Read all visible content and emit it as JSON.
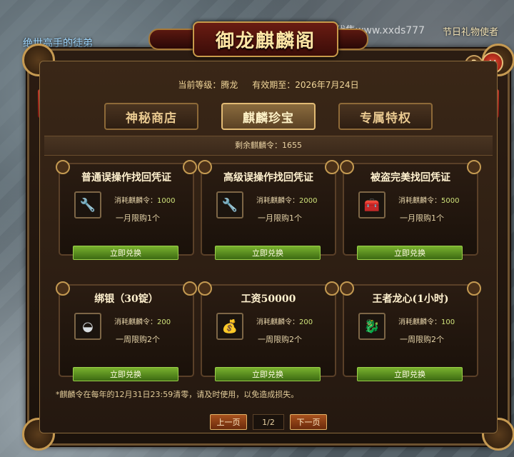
{
  "scene": {
    "top_left_text": "绝世高手的徒弟",
    "top_right_text": "节日礼物使者",
    "watermark": "代售www.xxds777"
  },
  "window": {
    "title": "御龙麒麟阁",
    "help_label": "?",
    "close_label": "×",
    "current_level_label": "当前等级：",
    "current_level_value": "腾龙",
    "expiry_label": "有效期至：",
    "expiry_value": "2026年7月24日"
  },
  "tabs": [
    {
      "label": "神秘商店",
      "active": false
    },
    {
      "label": "麒麟珍宝",
      "active": true
    },
    {
      "label": "专属特权",
      "active": false
    }
  ],
  "remaining": "剩余麒麟令：1655",
  "items": [
    {
      "title": "普通误操作找回凭证",
      "icon": "wrench-icon",
      "glyph": "🔧",
      "cost_label": "消耗麒麟令：",
      "cost": "1000",
      "limit": "一月限购1个",
      "button": "立即兑换"
    },
    {
      "title": "高级误操作找回凭证",
      "icon": "wrench-icon",
      "glyph": "🔧",
      "cost_label": "消耗麒麟令：",
      "cost": "2000",
      "limit": "一月限购1个",
      "button": "立即兑换"
    },
    {
      "title": "被盗完美找回凭证",
      "icon": "chest-icon",
      "glyph": "🧰",
      "cost_label": "消耗麒麟令：",
      "cost": "5000",
      "limit": "一月限购1个",
      "button": "立即兑换"
    },
    {
      "title": "绑银（30锭）",
      "icon": "silver-ingot-icon",
      "glyph": "◒",
      "cost_label": "消耗麒麟令：",
      "cost": "200",
      "limit": "一周限购2个",
      "button": "立即兑换"
    },
    {
      "title": "工资50000",
      "icon": "gold-coins-icon",
      "glyph": "💰",
      "cost_label": "消耗麒麟令：",
      "cost": "200",
      "limit": "一周限购2个",
      "button": "立即兑换"
    },
    {
      "title": "王者龙心(1小时)",
      "icon": "dragon-heart-icon",
      "glyph": "🐉",
      "cost_label": "消耗麒麟令：",
      "cost": "100",
      "limit": "一周限购2个",
      "button": "立即兑换"
    }
  ],
  "footnote": "*麒麟令在每年的12月31日23:59清零，请及时使用，以免造成损失。",
  "pager": {
    "prev": "上一页",
    "page": "1/2",
    "next": "下一页"
  },
  "colors": {
    "accent_gold": "#e2bb74",
    "button_green": "#79b22e",
    "cost_green": "#cfe27a"
  }
}
